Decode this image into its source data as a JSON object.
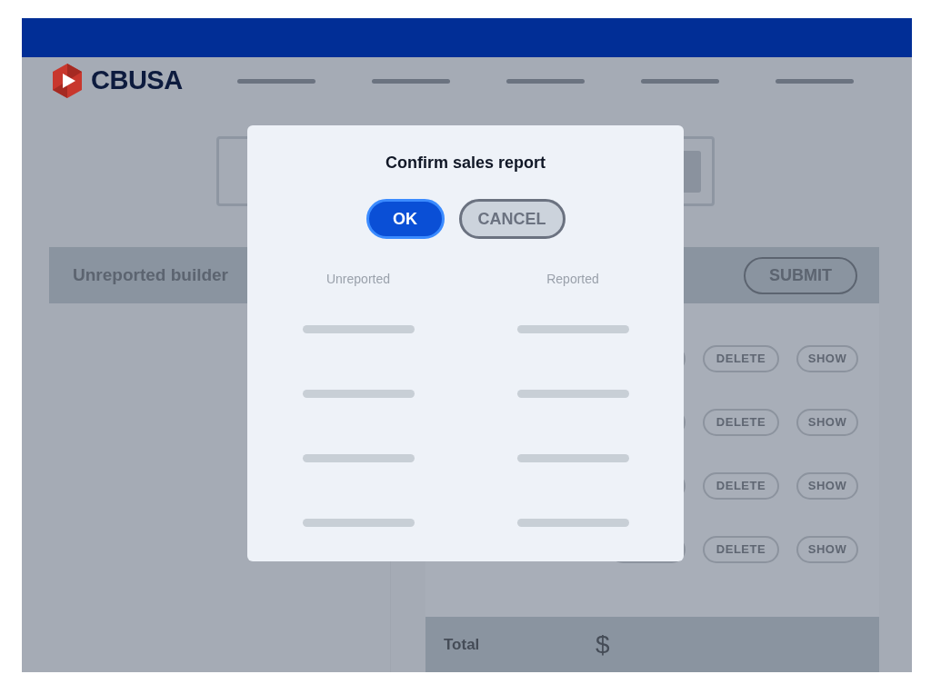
{
  "brand": {
    "name": "CBUSA"
  },
  "panel": {
    "title": "Unreported builder",
    "submit": "SUBMIT",
    "rows": [
      {
        "buttons": [
          "DELETE",
          "SHOW"
        ]
      },
      {
        "buttons": [
          "DELETE",
          "SHOW"
        ]
      },
      {
        "buttons": [
          "DELETE",
          "SHOW"
        ]
      },
      {
        "buttons": [
          "DELETE",
          "SHOW"
        ]
      }
    ],
    "total": {
      "label": "Total",
      "currency": "$"
    }
  },
  "dialog": {
    "title": "Confirm sales report",
    "ok": "OK",
    "cancel": "CANCEL",
    "columns": [
      "Unreported",
      "Reported"
    ]
  }
}
